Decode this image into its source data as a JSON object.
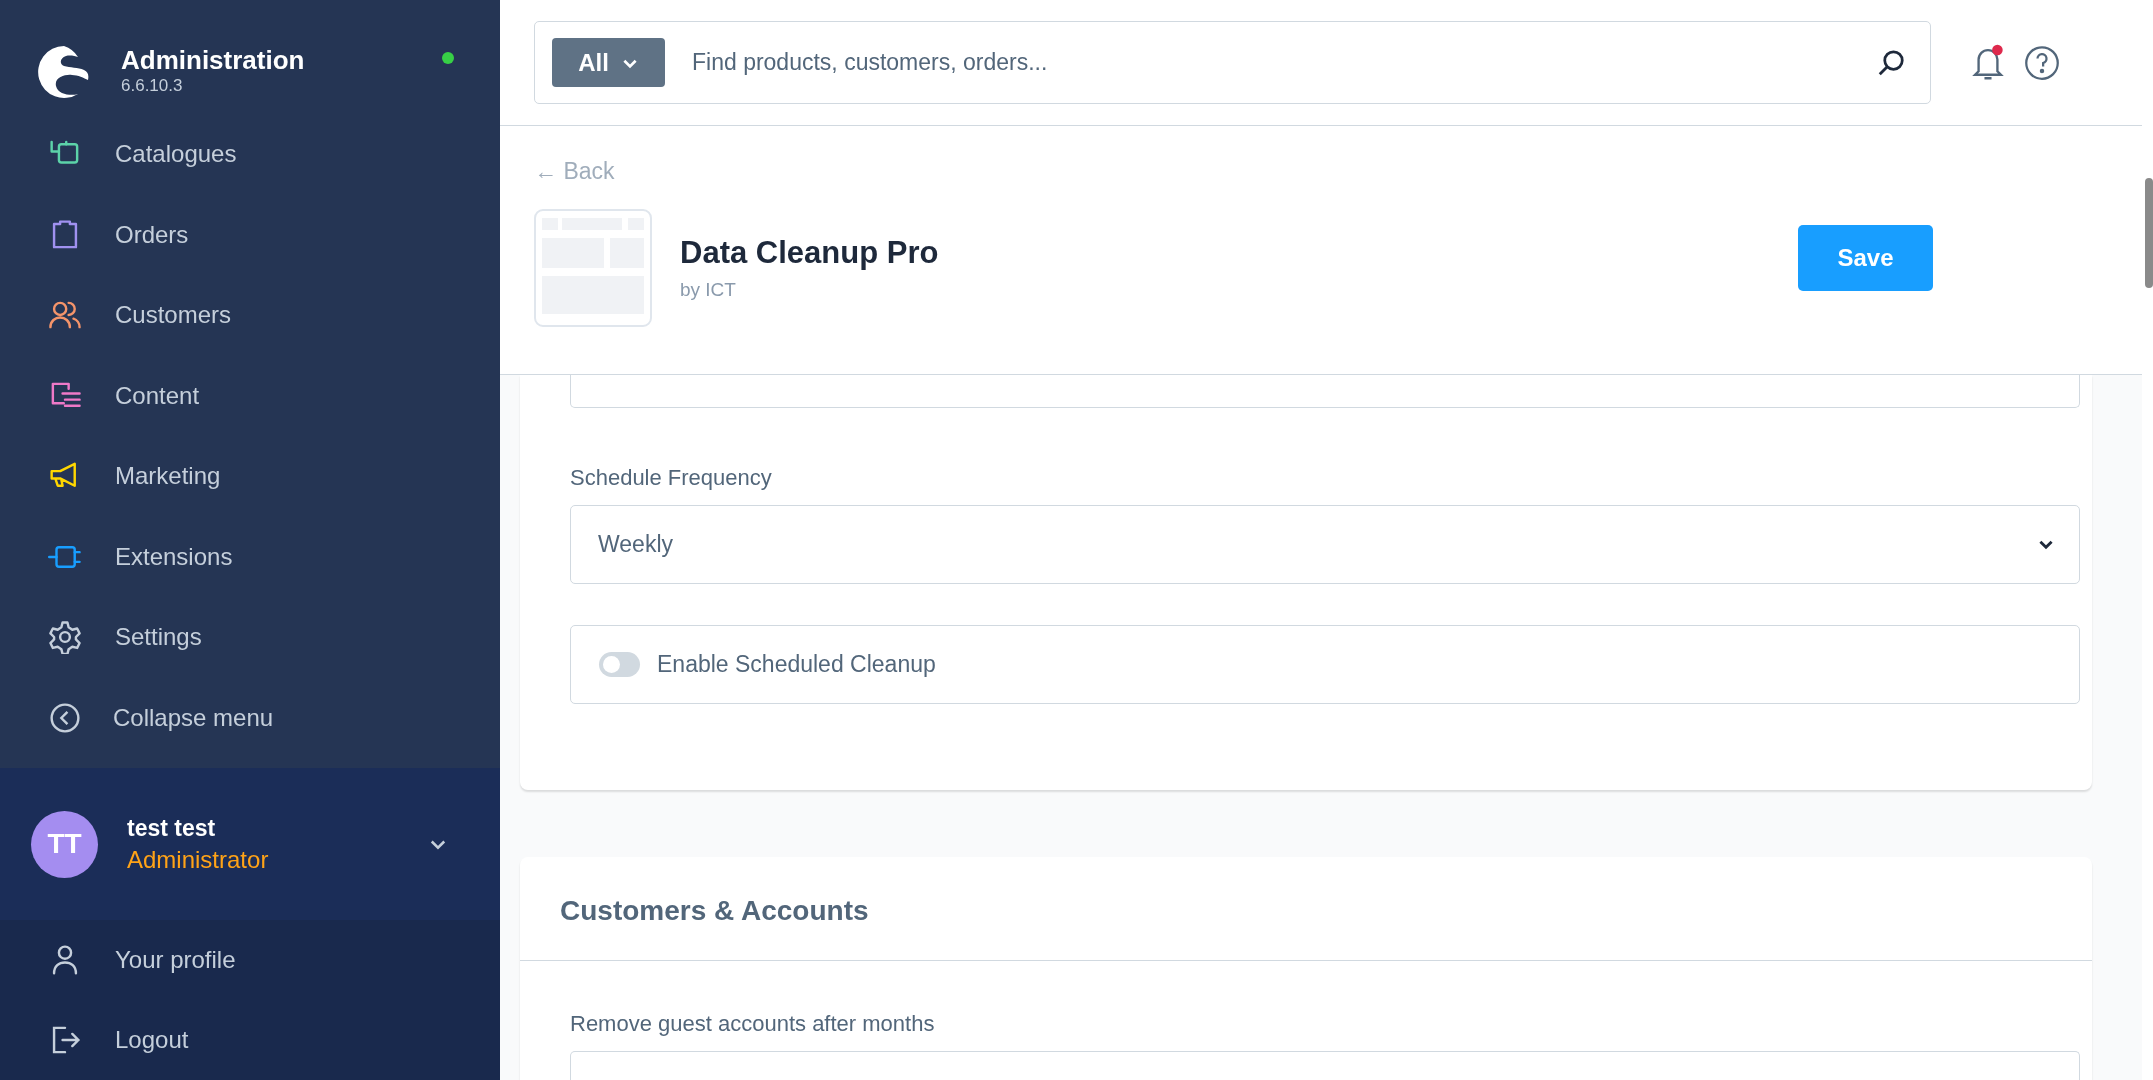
{
  "sidebar": {
    "app_name": "Administration",
    "version": "6.6.10.3",
    "items": [
      {
        "label": "Catalogues",
        "color": "#5cd3a9"
      },
      {
        "label": "Orders",
        "color": "#a091f0"
      },
      {
        "label": "Customers",
        "color": "#f4946a"
      },
      {
        "label": "Content",
        "color": "#f079c8"
      },
      {
        "label": "Marketing",
        "color": "#ffd700"
      },
      {
        "label": "Extensions",
        "color": "#189eff"
      },
      {
        "label": "Settings",
        "color": "#c5cfdb"
      }
    ],
    "collapse": "Collapse menu",
    "user": {
      "initials": "TT",
      "name": "test test",
      "role": "Administrator"
    },
    "user_menu": [
      {
        "label": "Your profile"
      },
      {
        "label": "Logout"
      }
    ]
  },
  "search": {
    "scope": "All",
    "placeholder": "Find products, customers, orders..."
  },
  "notifications": {
    "unread": true
  },
  "page": {
    "back": "← Back",
    "title": "Data Cleanup Pro",
    "vendor": "by ICT",
    "save": "Save"
  },
  "sections": [
    {
      "fields": [
        {
          "kind": "partial"
        },
        {
          "kind": "select",
          "label": "Schedule Frequency",
          "value": "Weekly"
        },
        {
          "kind": "switch",
          "label": "Enable Scheduled Cleanup",
          "on": false
        }
      ]
    },
    {
      "title": "Customers & Accounts",
      "fields": [
        {
          "kind": "input",
          "label": "Remove guest accounts after months"
        }
      ]
    }
  ]
}
